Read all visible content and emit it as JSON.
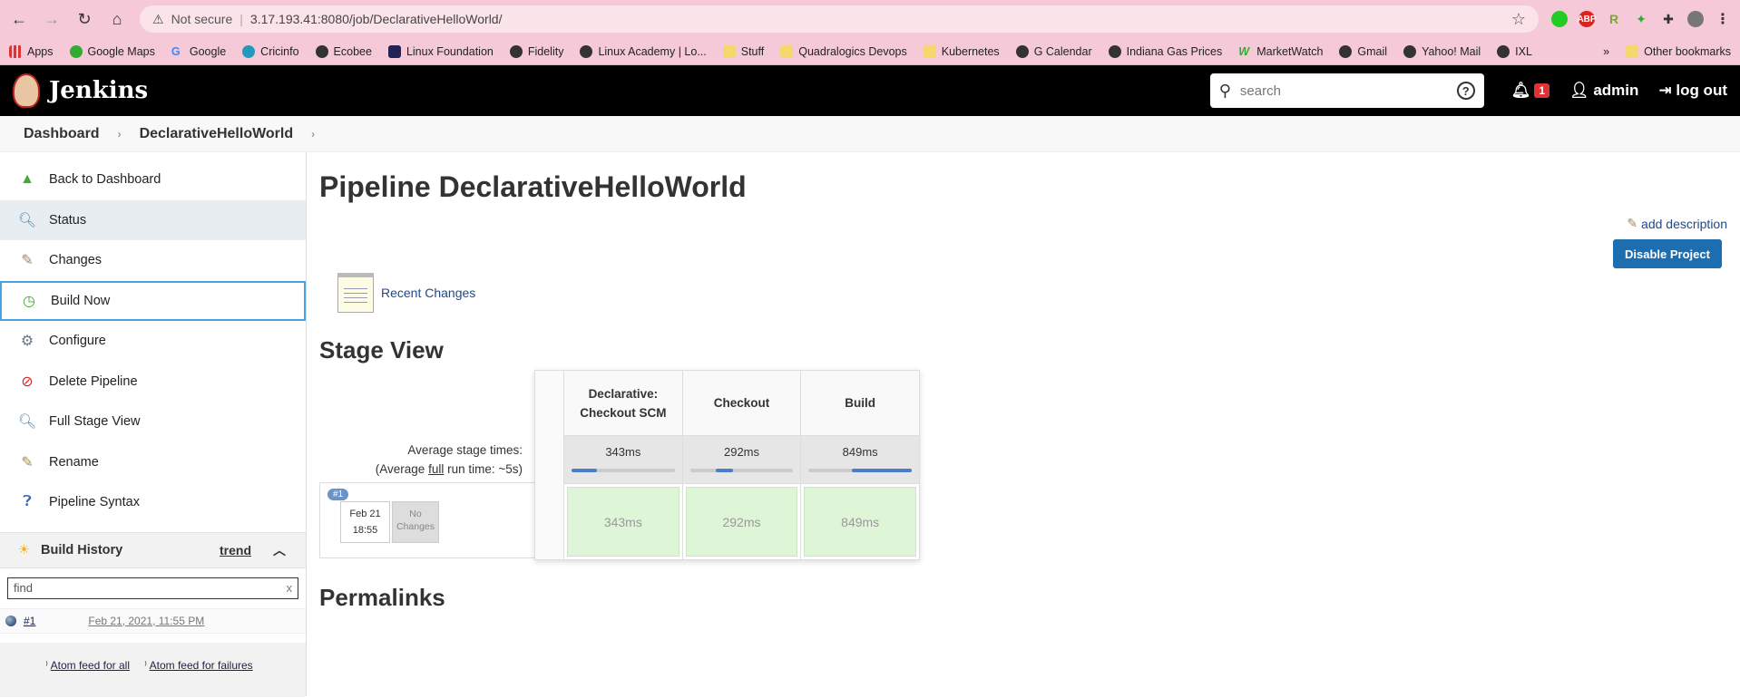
{
  "browser": {
    "security": "Not secure",
    "url": "3.17.193.41:8080/job/DeclarativeHelloWorld/",
    "bookmarks": [
      "Apps",
      "Google Maps",
      "Google",
      "Cricinfo",
      "Ecobee",
      "Linux Foundation",
      "Fidelity",
      "Linux Academy | Lo...",
      "Stuff",
      "Quadralogics Devops",
      "Kubernetes",
      "G Calendar",
      "Indiana Gas Prices",
      "MarketWatch",
      "Gmail",
      "Yahoo! Mail",
      "IXL"
    ],
    "more": "»",
    "other_bookmarks": "Other bookmarks"
  },
  "header": {
    "logo": "Jenkins",
    "search_placeholder": "search",
    "help": "?",
    "notifications": "1",
    "user": "admin",
    "logout": "log out"
  },
  "breadcrumb": [
    "Dashboard",
    "DeclarativeHelloWorld"
  ],
  "sidebar": {
    "items": [
      "Back to Dashboard",
      "Status",
      "Changes",
      "Build Now",
      "Configure",
      "Delete Pipeline",
      "Full Stage View",
      "Rename",
      "Pipeline Syntax"
    ],
    "build_history": {
      "title": "Build History",
      "trend": "trend",
      "find": "find",
      "clear": "x",
      "builds": [
        {
          "num": "#1",
          "date": "Feb 21, 2021, 11:55 PM"
        }
      ],
      "feed_all": "Atom feed for all",
      "feed_failures": "Atom feed for failures"
    }
  },
  "main": {
    "title": "Pipeline DeclarativeHelloWorld",
    "add_description": "add description",
    "disable_button": "Disable Project",
    "recent_changes": "Recent Changes",
    "stage_view_title": "Stage View",
    "avg_stage_times": "Average stage times:",
    "avg_full_prefix": "(Average ",
    "avg_full_word": "full",
    "avg_full_suffix": " run time: ~5s)",
    "run": {
      "tag": "#1",
      "date": "Feb 21",
      "time": "18:55",
      "changes": "No Changes"
    },
    "stages": [
      {
        "name": "Declarative: Checkout SCM",
        "avg": "343ms",
        "cell": "343ms",
        "bar_start": 0.0,
        "bar_end": 0.25
      },
      {
        "name": "Checkout",
        "avg": "292ms",
        "cell": "292ms",
        "bar_start": 0.25,
        "bar_end": 0.42
      },
      {
        "name": "Build",
        "avg": "849ms",
        "cell": "849ms",
        "bar_start": 0.42,
        "bar_end": 1.0
      }
    ],
    "permalinks_title": "Permalinks"
  }
}
